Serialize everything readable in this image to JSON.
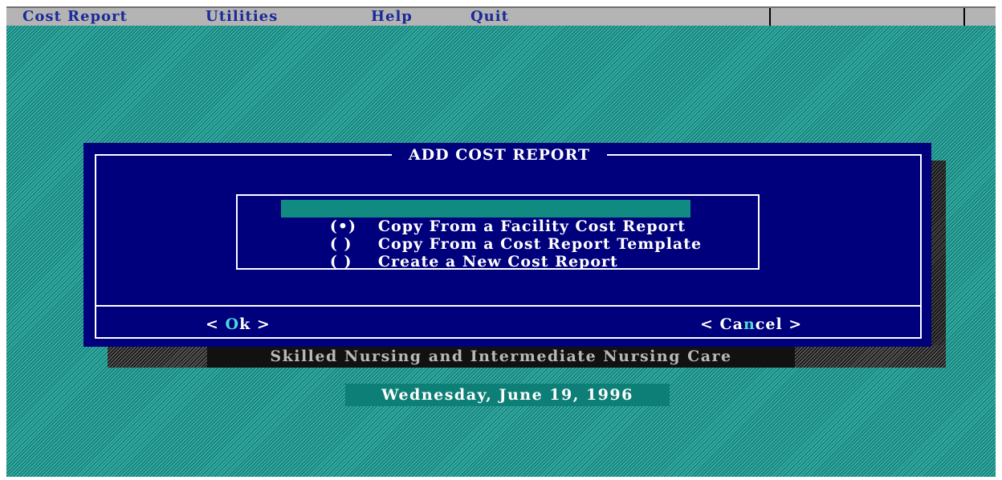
{
  "menubar": {
    "items": [
      {
        "label": "Cost Report"
      },
      {
        "label": "Utilities"
      },
      {
        "label": "Help"
      },
      {
        "label": "Quit"
      }
    ]
  },
  "dialog": {
    "title": "ADD COST REPORT",
    "options": [
      {
        "radio": "(•)",
        "label": "Copy From a Facility Cost Report",
        "selected": true
      },
      {
        "radio": "( )",
        "label": "Copy From a Cost Report Template",
        "selected": false
      },
      {
        "radio": "( )",
        "label": "Create a New Cost Report",
        "selected": false
      }
    ],
    "ok_button": {
      "left": "< ",
      "hotkey": "O",
      "rest": "k",
      "right": " >"
    },
    "cancel_button": {
      "left": "< Ca",
      "hotkey": "n",
      "rest": "cel",
      "right": " >"
    }
  },
  "status": {
    "text": "Skilled Nursing and Intermediate Nursing Care"
  },
  "date": {
    "text": "Wednesday, June 19, 1996"
  },
  "colors": {
    "background": "#1a8f87",
    "dialog": "#00007c",
    "menubar": "#b4b4b4",
    "menu_text": "#1a2a9a",
    "selection": "#118a82",
    "hotkey": "#4ed8d8"
  }
}
